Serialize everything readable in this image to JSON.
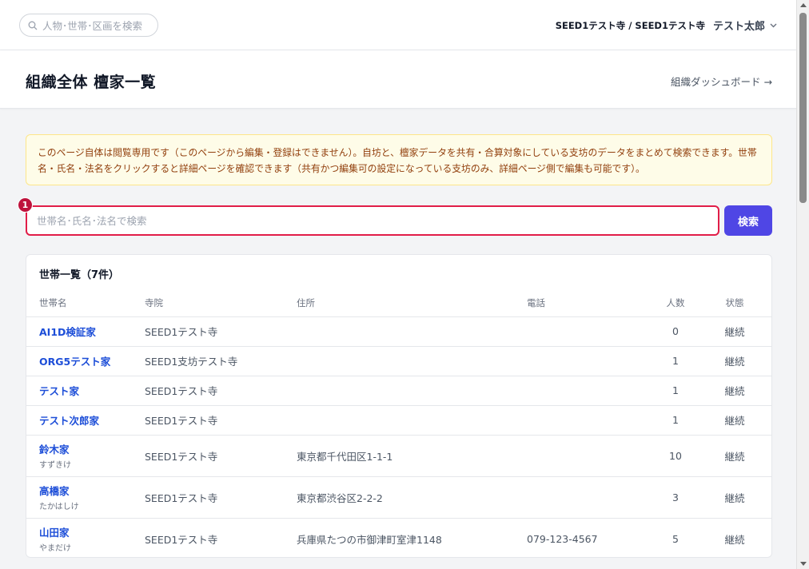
{
  "topbar": {
    "search_placeholder": "人物･世帯･区画を検索",
    "temple_path": "SEED1テスト寺 / SEED1テスト寺",
    "user_name": "テスト太郎"
  },
  "header": {
    "title": "組織全体 檀家一覧",
    "dashboard_link": "組織ダッシュボード →"
  },
  "notice": {
    "text": "このページ自体は閲覧専用です（このページから編集・登録はできません）。自坊と、檀家データを共有・合算対象にしている支坊のデータをまとめて検索できます。世帯名・氏名・法名をクリックすると詳細ページを確認できます（共有かつ編集可の設定になっている支坊のみ、詳細ページ側で編集も可能です）。"
  },
  "search": {
    "placeholder": "世帯名･氏名･法名で検索",
    "value": "",
    "button_label": "検索",
    "marker": "1"
  },
  "table": {
    "title": "世帯一覧（7件）",
    "columns": [
      "世帯名",
      "寺院",
      "住所",
      "電話",
      "人数",
      "状態"
    ],
    "rows": [
      {
        "name": "AI1D検証家",
        "kana": "",
        "temple": "SEED1テスト寺",
        "address": "",
        "phone": "",
        "count": "0",
        "status": "継続"
      },
      {
        "name": "ORG5テスト家",
        "kana": "",
        "temple": "SEED1支坊テスト寺",
        "address": "",
        "phone": "",
        "count": "1",
        "status": "継続"
      },
      {
        "name": "テスト家",
        "kana": "",
        "temple": "SEED1テスト寺",
        "address": "",
        "phone": "",
        "count": "1",
        "status": "継続"
      },
      {
        "name": "テスト次郎家",
        "kana": "",
        "temple": "SEED1テスト寺",
        "address": "",
        "phone": "",
        "count": "1",
        "status": "継続"
      },
      {
        "name": "鈴木家",
        "kana": "すずきけ",
        "temple": "SEED1テスト寺",
        "address": "東京都千代田区1-1-1",
        "phone": "",
        "count": "10",
        "status": "継続"
      },
      {
        "name": "高橋家",
        "kana": "たかはしけ",
        "temple": "SEED1テスト寺",
        "address": "東京都渋谷区2-2-2",
        "phone": "",
        "count": "3",
        "status": "継続"
      },
      {
        "name": "山田家",
        "kana": "やまだけ",
        "temple": "SEED1テスト寺",
        "address": "兵庫県たつの市御津町室津1148",
        "phone": "079-123-4567",
        "count": "5",
        "status": "継続"
      }
    ]
  }
}
